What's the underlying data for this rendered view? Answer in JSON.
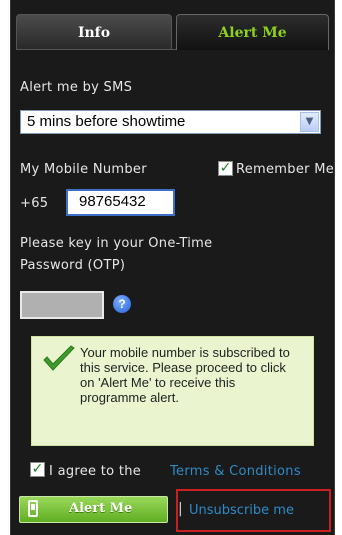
{
  "tabs": [
    {
      "label": "Info",
      "active": false
    },
    {
      "label": "Alert Me",
      "active": true
    }
  ],
  "colors": {
    "accent": "#8ed21d",
    "panel": "#1a1a1a",
    "link": "#2f8ac6",
    "highlight": "#cc1f1f",
    "notice_bg": "#eaf5cf"
  },
  "sms": {
    "label": "Alert me by SMS",
    "selected": "5 mins before showtime",
    "dropdown_icon": "chevron-down-icon"
  },
  "mobile": {
    "label": "My Mobile Number",
    "remember_label": "Remember Me",
    "remember_checked": true,
    "prefix": "+65",
    "value": "98765432"
  },
  "otp": {
    "label_line1": "Please key in your One-Time",
    "label_line2": "Password (OTP)",
    "value": "",
    "help_icon": "help-icon",
    "help_glyph": "?"
  },
  "notice": {
    "icon": "check-icon",
    "text": "Your mobile number is subscribed to this service. Please proceed to click on 'Alert Me' to receive this programme alert."
  },
  "terms": {
    "checked": true,
    "prefix": "I agree to the",
    "link": "Terms & Conditions"
  },
  "actions": {
    "alert_label": "Alert Me",
    "alert_icon": "phone-icon",
    "separator": "|",
    "unsubscribe_label": "Unsubscribe me"
  }
}
